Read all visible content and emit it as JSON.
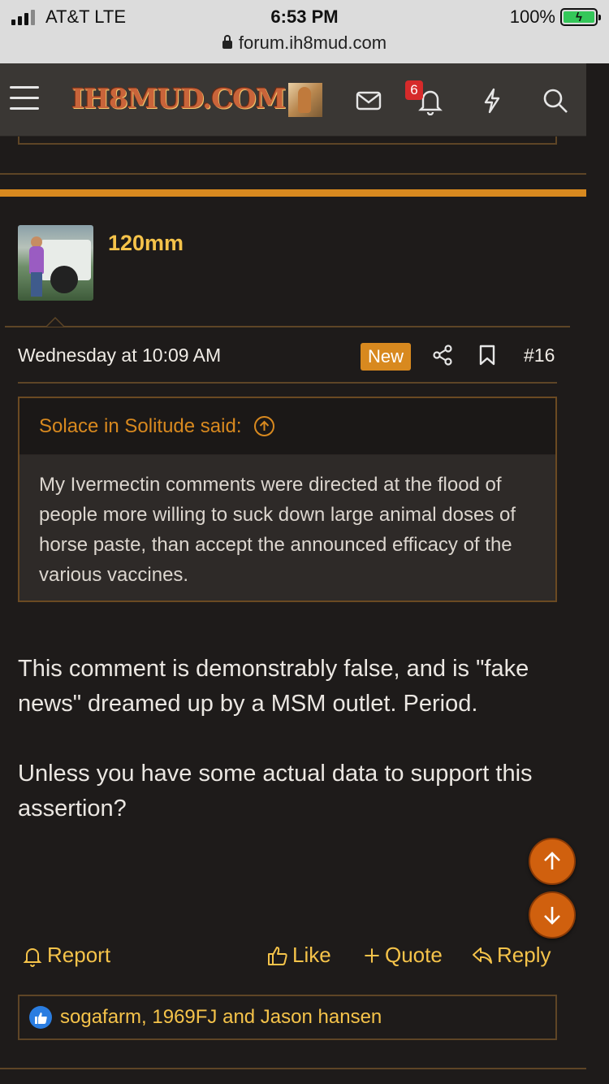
{
  "status_bar": {
    "carrier": "AT&T   LTE",
    "time": "6:53 PM",
    "battery": "100%",
    "url": "forum.ih8mud.com"
  },
  "header": {
    "logo_text": "IH8MUD.COM",
    "notification_count": "6",
    "icons": [
      "menu-icon",
      "user-avatar",
      "envelope-icon",
      "bell-icon",
      "lightning-icon",
      "search-icon"
    ]
  },
  "post": {
    "username": "120mm",
    "date": "Wednesday at 10:09 AM",
    "new_badge": "New",
    "post_number": "#16",
    "quote": {
      "author": "Solace in Solitude said:",
      "text": "My Ivermectin comments were directed at the flood of people more willing to suck down large animal doses of horse paste, than accept the announced efficacy of the various vaccines."
    },
    "paragraphs": [
      "This comment is demonstrably false, and is \"fake news\" dreamed up by a MSM outlet. Period.",
      "Unless you have some actual data to support this assertion?"
    ],
    "actions": {
      "report": "Report",
      "like": "Like",
      "quote": "Quote",
      "reply": "Reply"
    },
    "reactions": "sogafarm, 1969FJ and Jason hansen"
  },
  "colors": {
    "accent": "#d8891f",
    "username": "#f5c34a",
    "background": "#1e1b1a",
    "header": "#3a3734"
  }
}
